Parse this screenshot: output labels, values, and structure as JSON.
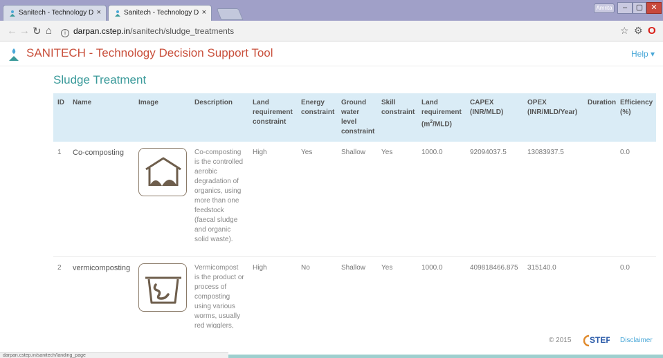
{
  "browser": {
    "tabs": [
      {
        "title": "Sanitech - Technology D",
        "close": "×",
        "active": false
      },
      {
        "title": "Sanitech - Technology D",
        "close": "×",
        "active": true
      }
    ],
    "profile_label": "Amrita",
    "window_controls": {
      "minimize": "–",
      "maximize": "▢",
      "close": "✕"
    },
    "url_host": "darpan.cstep.in",
    "url_path": "/sanitech/sludge_treatments",
    "status_text": "darpan.cstep.in/sanitech/landing_page"
  },
  "app": {
    "title": "SANITECH - Technology Decision Support Tool",
    "help_label": "Help ▾",
    "accent_color": "#c9503c",
    "link_color": "#4aa8d8"
  },
  "section_title": "Sludge Treatment",
  "table": {
    "headers": {
      "id": "ID",
      "name": "Name",
      "image": "Image",
      "description": "Description",
      "land_constraint": "Land requirement constraint",
      "energy": "Energy constraint",
      "groundwater": "Ground water level constraint",
      "skill": "Skill constraint",
      "land_req_pre": "Land requirement (m",
      "land_req_sup": "2",
      "land_req_post": "/MLD)",
      "capex": "CAPEX (INR/MLD)",
      "opex": "OPEX (INR/MLD/Year)",
      "duration": "Duration",
      "efficiency": "Efficiency (%)"
    },
    "rows": [
      {
        "id": "1",
        "name": "Co-composting",
        "image_icon": "heap-under-roof-icon",
        "description": "Co-composting is the controlled aerobic degradation of organics, using more than one feedstock (faecal sludge and organic solid waste).",
        "land_constraint": "High",
        "energy": "Yes",
        "groundwater": "Shallow",
        "skill": "Yes",
        "land_req": "1000.0",
        "capex": "92094037.5",
        "opex": "13083937.5",
        "duration": "",
        "efficiency": "0.0"
      },
      {
        "id": "2",
        "name": "vermicomposting",
        "image_icon": "worm-bin-icon",
        "description": "Vermicompost is the product or process of composting using various worms, usually red wigglers,",
        "land_constraint": "High",
        "energy": "No",
        "groundwater": "Shallow",
        "skill": "Yes",
        "land_req": "1000.0",
        "capex": "409818466.875",
        "opex": "315140.0",
        "duration": "",
        "efficiency": "0.0"
      }
    ]
  },
  "footer": {
    "copyright": "© 2015",
    "brand": "STEP",
    "disclaimer": "Disclaimer"
  }
}
